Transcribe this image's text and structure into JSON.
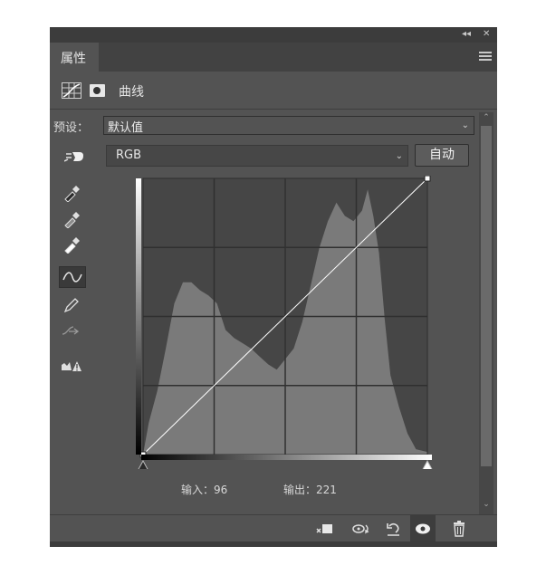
{
  "panel": {
    "tab_label": "属性",
    "adjustment_title": "曲线",
    "preset_label": "预设：",
    "preset_value": "默认值",
    "channel_value": "RGB",
    "auto_button_label": "自动",
    "input_label": "输入：96",
    "output_label": "输出：221"
  },
  "icons": {
    "collapse": "double-chevron-left-icon",
    "close": "close-icon",
    "menu": "panel-menu-icon",
    "curves_adjustment": "curves-adjustment-icon",
    "mask": "layer-mask-icon",
    "on_image_adjust": "on-image-adjust-icon",
    "black_point": "eyedropper-black-icon",
    "gray_point": "eyedropper-gray-icon",
    "white_point": "eyedropper-white-icon",
    "edit_points": "curve-points-icon",
    "draw_curve": "pencil-icon",
    "smooth": "smooth-curve-icon",
    "clipping_warning": "clipping-warning-icon",
    "clip_to_layer": "clip-to-layer-icon",
    "view_previous": "view-previous-state-icon",
    "reset": "reset-icon",
    "visibility": "eye-icon",
    "delete": "trash-icon"
  },
  "curve": {
    "input_value": 96,
    "output_value": 221,
    "endpoints": [
      [
        0,
        0
      ],
      [
        255,
        255
      ]
    ]
  },
  "colors": {
    "panel_bg": "#535353",
    "graph_bg": "#464646",
    "histogram": "#7a7a7a",
    "grid": "#303030",
    "curve": "#ffffff"
  }
}
